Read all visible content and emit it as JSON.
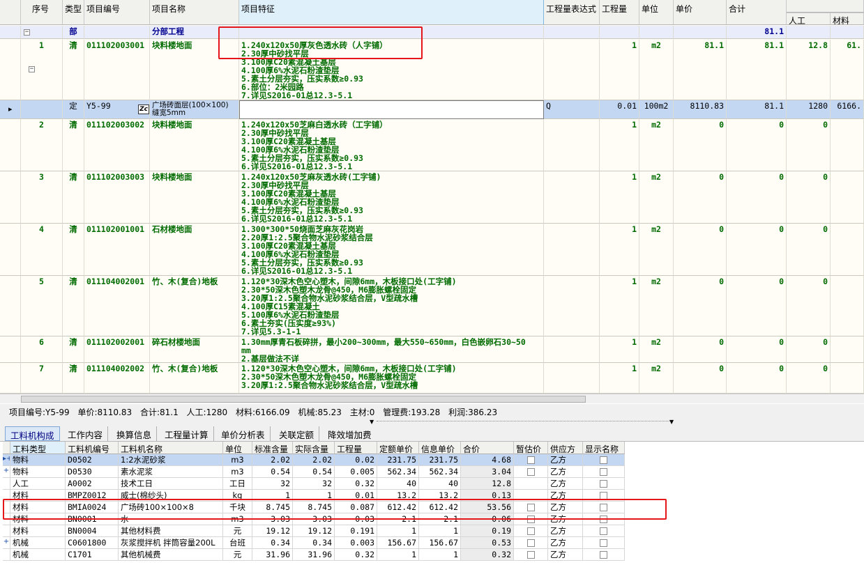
{
  "upper_headers": [
    "序号",
    "类型",
    "项目编号",
    "项目名称",
    "项目特征",
    "工程量表达式",
    "工程量",
    "单位",
    "单价",
    "合计",
    "人工",
    "材料"
  ],
  "rows": [
    {
      "seq": "",
      "type": "部",
      "code": "",
      "name": "分部工程",
      "feature": "",
      "expr": "",
      "qty": "",
      "unit": "",
      "price": "",
      "total": "81.1",
      "labor": "",
      "material": "",
      "kind": "dept"
    },
    {
      "seq": "1",
      "type": "清",
      "code": "011102003001",
      "name": "块料楼地面",
      "feature": "1.240x120x50厚灰色透水砖（人字铺）\n2.30厚中砂找平层\n3.100厚C20素混凝土基层\n4.100厚6%水泥石粉渣垫层\n5.素土分层夯实，压实系数≥0.93\n6.部位：2米园路\n7.详见S2016-01总12.3-5.1",
      "expr": "",
      "qty": "1",
      "unit": "m2",
      "price": "81.1",
      "total": "81.1",
      "labor": "12.8",
      "material": "61.",
      "kind": "bill"
    },
    {
      "seq": "",
      "type": "定",
      "code": "Y5-99",
      "name": "广场砖面层(100×100)\n缝宽5mm",
      "feature": "",
      "expr": "Q",
      "qty": "0.01",
      "unit": "100m2",
      "price": "8110.83",
      "total": "81.1",
      "labor": "1280",
      "material": "6166.",
      "kind": "quota"
    },
    {
      "seq": "2",
      "type": "清",
      "code": "011102003002",
      "name": "块料楼地面",
      "feature": "1.240x120x50芝麻白透水砖（工字铺）\n2.30厚中砂找平层\n3.100厚C20素混凝土基层\n4.100厚6%水泥石粉渣垫层\n5.素土分层夯实，压实系数≥0.93\n6.详见S2016-01总12.3-5.1",
      "expr": "",
      "qty": "1",
      "unit": "m2",
      "price": "0",
      "total": "0",
      "labor": "0",
      "material": "",
      "kind": "bill"
    },
    {
      "seq": "3",
      "type": "清",
      "code": "011102003003",
      "name": "块料楼地面",
      "feature": "1.240x120x50芝麻灰透水砖(工字铺)\n2.30厚中砂找平层\n3.100厚C20素混凝土基层\n4.100厚6%水泥石粉渣垫层\n5.素土分层夯实，压实系数≥0.93\n6.详见S2016-01总12.3-5.1",
      "expr": "",
      "qty": "1",
      "unit": "m2",
      "price": "0",
      "total": "0",
      "labor": "0",
      "material": "",
      "kind": "bill"
    },
    {
      "seq": "4",
      "type": "清",
      "code": "011102001001",
      "name": "石材楼地面",
      "feature": "1.300*300*50烧面芝麻灰花岗岩\n2.20厚1:2.5聚合物水泥砂浆结合层\n3.100厚C20素混凝土基层\n4.100厚6%水泥石粉渣垫层\n5.素土分层夯实，压实系数≥0.93\n6.详见S2016-01总12.3-5.1",
      "expr": "",
      "qty": "1",
      "unit": "m2",
      "price": "0",
      "total": "0",
      "labor": "0",
      "material": "",
      "kind": "bill"
    },
    {
      "seq": "5",
      "type": "清",
      "code": "011104002001",
      "name": "竹、木(复合)地板",
      "feature": "1.120*30深木色空心塑木，间隙6mm，木板接口处(工字铺)\n2.30*50深木色塑木龙骨@450，M6膨胀螺栓固定\n3.20厚1:2.5聚合物水泥砂浆结合层，V型疏水槽\n4.100厚C15素混凝土\n5.100厚6%水泥石粉渣垫层\n6.素土夯实(压实度≥93%)\n7.详见5.3-1-1",
      "expr": "",
      "qty": "1",
      "unit": "m2",
      "price": "0",
      "total": "0",
      "labor": "0",
      "material": "",
      "kind": "bill"
    },
    {
      "seq": "6",
      "type": "清",
      "code": "011102002001",
      "name": "碎石材楼地面",
      "feature": "1.30mm厚青石板碎拼，最小200~300mm，最大550~650mm，白色嵌卵石30~50\nmm\n2.基层做法不详",
      "expr": "",
      "qty": "1",
      "unit": "m2",
      "price": "0",
      "total": "0",
      "labor": "0",
      "material": "",
      "kind": "bill"
    },
    {
      "seq": "7",
      "type": "清",
      "code": "011104002002",
      "name": "竹、木(复合)地板",
      "feature": "1.120*30深木色空心塑木，间隙6mm，木板接口处(工字铺)\n2.30*50深木色塑木龙骨@450，M6膨胀螺栓固定\n3.20厚1:2.5聚合物水泥砂浆结合层，V型疏水槽",
      "expr": "",
      "qty": "1",
      "unit": "m2",
      "price": "0",
      "total": "0",
      "labor": "0",
      "material": "",
      "kind": "bill"
    }
  ],
  "status": {
    "code": "项目编号:Y5-99",
    "price": "单价:8110.83",
    "total": "合计:81.1",
    "labor": "人工:1280",
    "material": "材料:6166.09",
    "machine": "机械:85.23",
    "main": "主材:0",
    "mgmt": "管理费:193.28",
    "profit": "利润:386.23"
  },
  "tabs": [
    "工料机构成",
    "工作内容",
    "换算信息",
    "工程量计算",
    "单价分析表",
    "关联定额",
    "降效增加费"
  ],
  "lower_headers": [
    "工料类型",
    "工料机编号",
    "工料机名称",
    "单位",
    "标准含量",
    "实际含量",
    "工程量",
    "定额单价",
    "信息单价",
    "合价",
    "暂估价",
    "供应方",
    "显示名称"
  ],
  "lower_rows": [
    {
      "mark": "▸+",
      "type": "物料",
      "code": "D0502",
      "name": "1:2水泥砂浆",
      "unit": "m3",
      "std": "2.02",
      "act": "2.02",
      "qty": "0.02",
      "quota_price": "231.75",
      "info_price": "231.75",
      "sum": "4.68",
      "supplier": "乙方",
      "selected": true
    },
    {
      "mark": "+",
      "type": "物料",
      "code": "D0530",
      "name": "素水泥浆",
      "unit": "m3",
      "std": "0.54",
      "act": "0.54",
      "qty": "0.005",
      "quota_price": "562.34",
      "info_price": "562.34",
      "sum": "3.04",
      "supplier": "乙方",
      "selected": false
    },
    {
      "mark": "",
      "type": "人工",
      "code": "A0002",
      "name": "技术工日",
      "unit": "工日",
      "std": "32",
      "act": "32",
      "qty": "0.32",
      "quota_price": "40",
      "info_price": "40",
      "sum": "12.8",
      "supplier": "乙方",
      "selected": false
    },
    {
      "mark": "",
      "type": "材料",
      "code": "BMPZ0012",
      "name": "威士(棉纱头)",
      "unit": "kg",
      "std": "1",
      "act": "1",
      "qty": "0.01",
      "quota_price": "13.2",
      "info_price": "13.2",
      "sum": "0.13",
      "supplier": "乙方",
      "selected": false
    },
    {
      "mark": "",
      "type": "材料",
      "code": "BMIA0024",
      "name": "广场砖100×100×8",
      "unit": "千块",
      "std": "8.745",
      "act": "8.745",
      "qty": "0.087",
      "quota_price": "612.42",
      "info_price": "612.42",
      "sum": "53.56",
      "supplier": "乙方",
      "selected": false
    },
    {
      "mark": "",
      "type": "材料",
      "code": "BN0001",
      "name": "水",
      "unit": "m3",
      "std": "3.03",
      "act": "3.03",
      "qty": "0.03",
      "quota_price": "2.1",
      "info_price": "2.1",
      "sum": "0.06",
      "supplier": "乙方",
      "selected": false
    },
    {
      "mark": "",
      "type": "材料",
      "code": "BN0004",
      "name": "其他材料费",
      "unit": "元",
      "std": "19.12",
      "act": "19.12",
      "qty": "0.191",
      "quota_price": "1",
      "info_price": "1",
      "sum": "0.19",
      "supplier": "乙方",
      "selected": false
    },
    {
      "mark": "+",
      "type": "机械",
      "code": "C0601800",
      "name": "灰浆搅拌机 拌筒容量200L",
      "unit": "台班",
      "std": "0.34",
      "act": "0.34",
      "qty": "0.003",
      "quota_price": "156.67",
      "info_price": "156.67",
      "sum": "0.53",
      "supplier": "乙方",
      "selected": false
    },
    {
      "mark": "",
      "type": "机械",
      "code": "C1701",
      "name": "其他机械费",
      "unit": "元",
      "std": "31.96",
      "act": "31.96",
      "qty": "0.32",
      "quota_price": "1",
      "info_price": "1",
      "sum": "0.32",
      "supplier": "乙方",
      "selected": false
    }
  ],
  "colors": {
    "accent_red": "#e4161a",
    "select_blue": "#c3d7f3",
    "bill_green": "#006b00",
    "dept_blue": "#000090"
  }
}
